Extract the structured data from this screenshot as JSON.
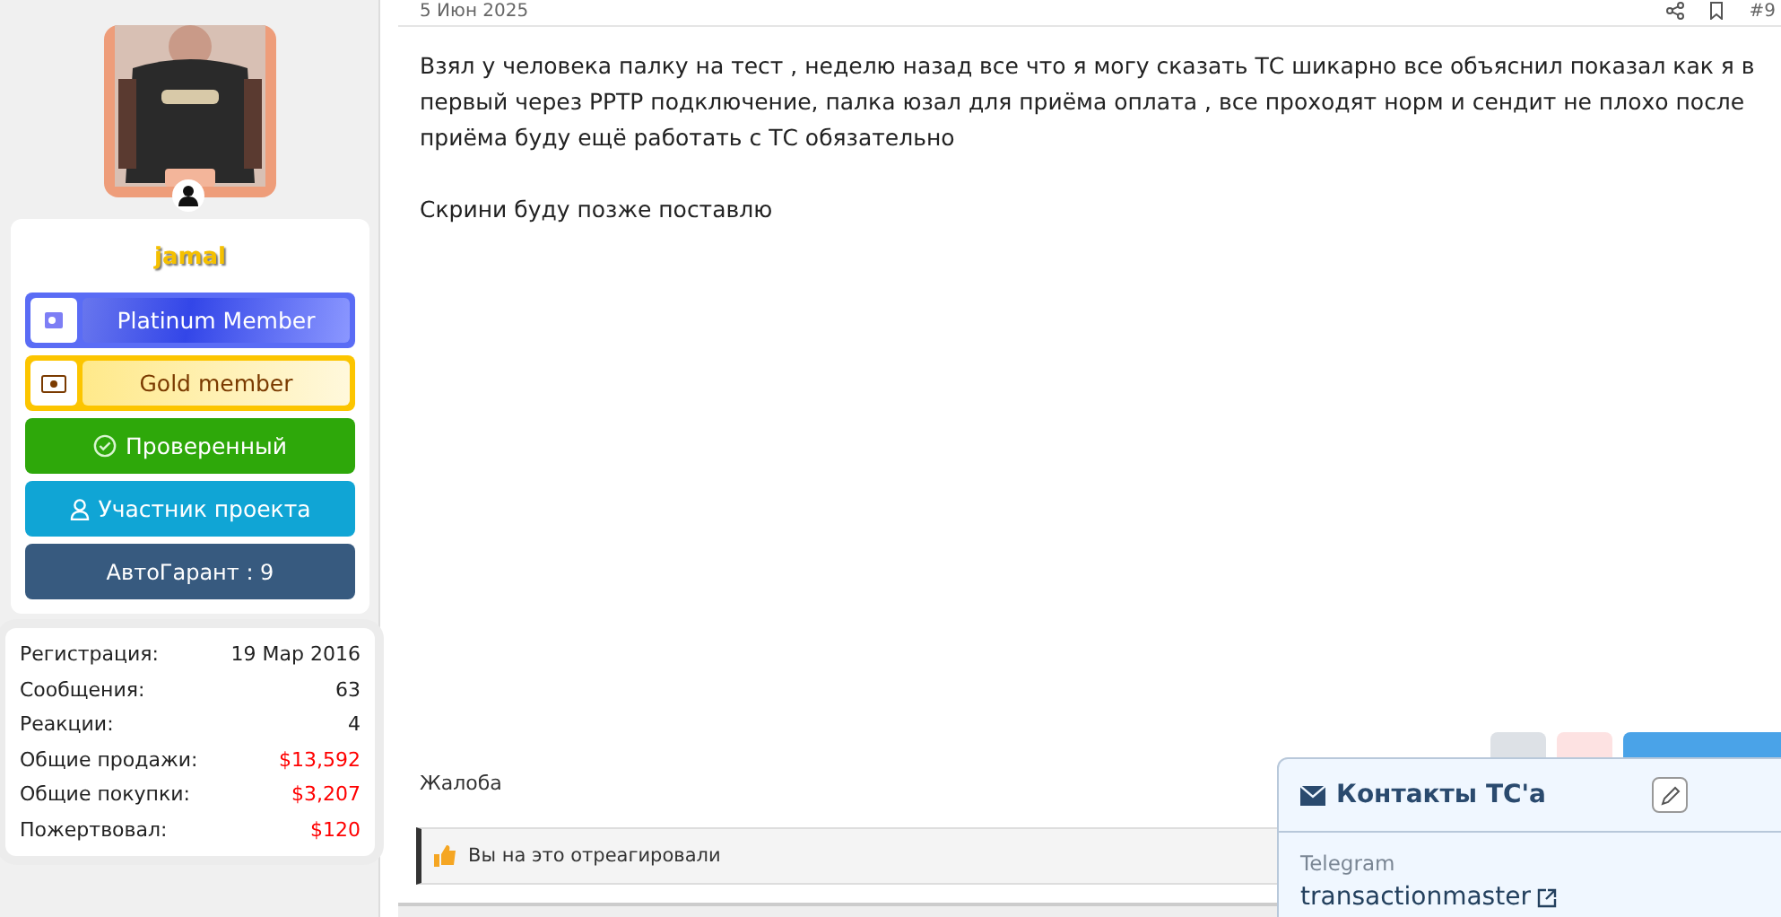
{
  "user": {
    "name": "jamal",
    "banners": [
      {
        "kind": "platinum",
        "label": "Platinum Member"
      },
      {
        "kind": "gold",
        "label": "Gold member"
      },
      {
        "kind": "verified",
        "label": "Проверенный"
      },
      {
        "kind": "member",
        "label": "Участник проекта"
      },
      {
        "kind": "guarantee",
        "label": "АвтоГарант : 9"
      }
    ],
    "stats": [
      {
        "label": "Регистрация:",
        "value": "19 Мар 2016",
        "highlight": false
      },
      {
        "label": "Сообщения:",
        "value": "63",
        "highlight": false
      },
      {
        "label": "Реакции:",
        "value": "4",
        "highlight": false
      },
      {
        "label": "Общие продажи:",
        "value": "$13,592",
        "highlight": true
      },
      {
        "label": "Общие покупки:",
        "value": "$3,207",
        "highlight": true
      },
      {
        "label": "Пожертвовал:",
        "value": "$120",
        "highlight": true
      }
    ]
  },
  "post": {
    "date": "5 Июн 2025",
    "number": "#9",
    "paragraphs": [
      "Взял у человека палку на тест , неделю назад все что я могу сказать ТС шикарно все объяснил показал как я в первый через PPTP подключение, палка юзал для приёма оплата , все проходят норм и сендит не плохо после приёма буду ещё работать с ТС обязательно",
      "Скрини буду позже поставлю"
    ],
    "report": "Жалоба",
    "reactions": "Вы на это отреагировали"
  },
  "contacts": {
    "title": "Контакты ТС'a",
    "items": [
      {
        "label": "Telegram",
        "value": "transactionmaster"
      }
    ]
  }
}
